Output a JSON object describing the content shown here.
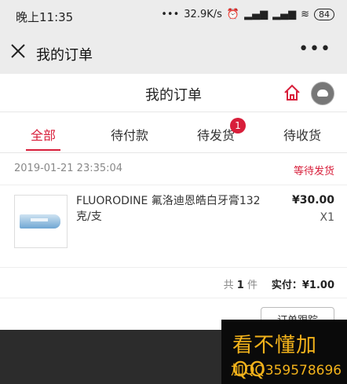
{
  "status_bar": {
    "time": "晚上11:35",
    "network_speed": "32.9K/s",
    "battery": "84"
  },
  "nav": {
    "title": "我的订单"
  },
  "page": {
    "title": "我的订单"
  },
  "tabs": [
    {
      "label": "全部",
      "active": true
    },
    {
      "label": "待付款"
    },
    {
      "label": "待发货",
      "badge": "1"
    },
    {
      "label": "待收货"
    }
  ],
  "order": {
    "date": "2019-01-21 23:35:04",
    "status": "等待发货",
    "item": {
      "name": "FLUORODINE 氟洛迪恩皓白牙膏132克/支",
      "price": "¥30.00",
      "qty": "X1"
    },
    "summary": {
      "count_prefix": "共",
      "count": "1",
      "count_suffix": "件",
      "paid": "实付：¥1.00"
    },
    "button": "订单跟踪"
  },
  "promo": {
    "line1": "看不懂加QQ",
    "line2": "加QQ359578696"
  },
  "colors": {
    "accent": "#d81e3a"
  }
}
